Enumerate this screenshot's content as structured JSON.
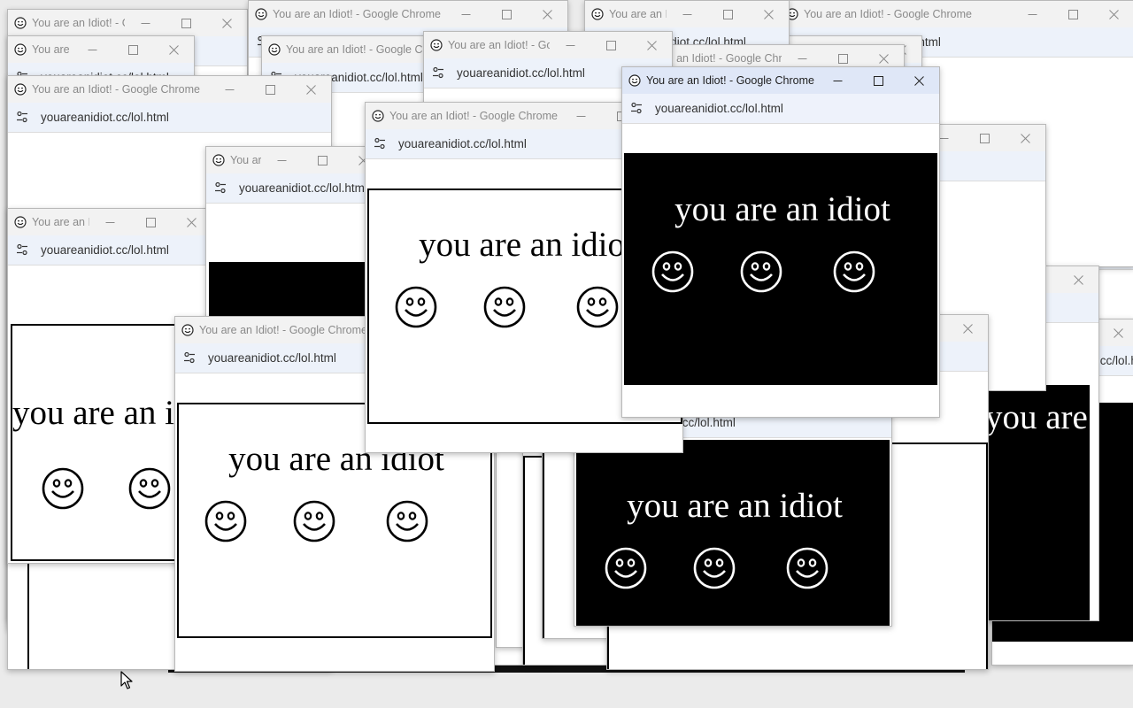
{
  "window": {
    "title": "You are an Idiot! - Google Chrome",
    "url": "youareanidiot.cc/lol.html",
    "message": "you are an idiot",
    "smiley_icon": "smiley-face-icon",
    "favicon_icon": "smiley-favicon-icon",
    "page_info_icon": "site-settings-icon"
  },
  "controls": {
    "minimize_icon": "minimize-icon",
    "maximize_icon": "maximize-icon",
    "close_icon": "close-icon"
  },
  "colors": {
    "titlebar_inactive": "#f2f2f2",
    "titlebar_active": "#dfe7f7",
    "addressbar": "#edf2fa",
    "panel_black": "#000000",
    "panel_white": "#ffffff"
  }
}
